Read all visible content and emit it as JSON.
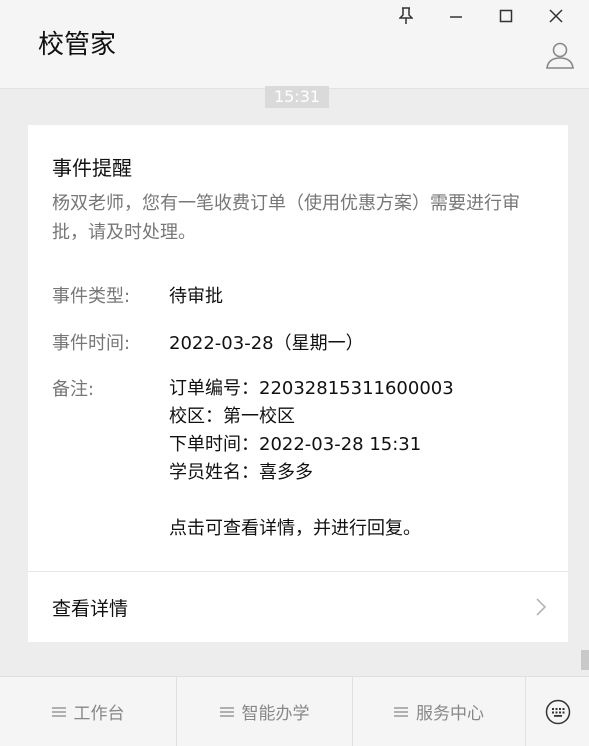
{
  "window": {
    "title": "校管家"
  },
  "chat": {
    "timestamp": "15:31"
  },
  "card": {
    "title": "事件提醒",
    "description": "杨双老师，您有一笔收费订单（使用优惠方案）需要进行审批，请及时处理。",
    "event_type_label": "事件类型:",
    "event_type_value": "待审批",
    "event_time_label": "事件时间:",
    "event_time_value": "2022-03-28（星期一）",
    "note_label": "备注:",
    "note_lines": [
      "订单编号：22032815311600003",
      "校区：第一校区",
      "下单时间：2022-03-28 15:31",
      "学员姓名：喜多多",
      "",
      "点击可查看详情，并进行回复。"
    ],
    "view_detail": "查看详情"
  },
  "bottom_menu": {
    "items": [
      {
        "label": "工作台"
      },
      {
        "label": "智能办学"
      },
      {
        "label": "服务中心"
      }
    ]
  }
}
